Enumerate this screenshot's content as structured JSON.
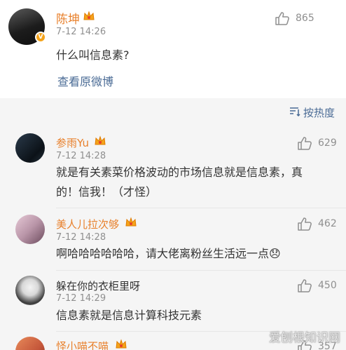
{
  "post": {
    "author": "陈坤",
    "time": "7-12 14:26",
    "likes": "865",
    "text": "什么叫信息素?",
    "view_original": "查看原微博"
  },
  "sort_label": "按热度",
  "comments": [
    {
      "author": "参雨Yu",
      "time": "7-12 14:28",
      "likes": "629",
      "text_line1": "就是有关素菜价格波动的市场信息就是信息素，真",
      "text_line2": "的！信我！（才怪）"
    },
    {
      "author": "美人儿拉次够",
      "time": "7-12 14:28",
      "likes": "462",
      "text_line1": "啊哈哈哈哈哈哈，请大佬离粉丝生活远一点😞"
    },
    {
      "author": "躲在你的衣柜里呀",
      "time": "7-12 14:29",
      "likes": "450",
      "text_line1": "信息素就是信息计算科技元素"
    },
    {
      "author": "怪小喵不喵",
      "likes": "357"
    }
  ],
  "watermark": "爱刨根知识网",
  "colors": {
    "name": "#e8802b",
    "link": "#4a6b95",
    "muted": "#8f8f8f",
    "bg": "#f5f5f5"
  }
}
